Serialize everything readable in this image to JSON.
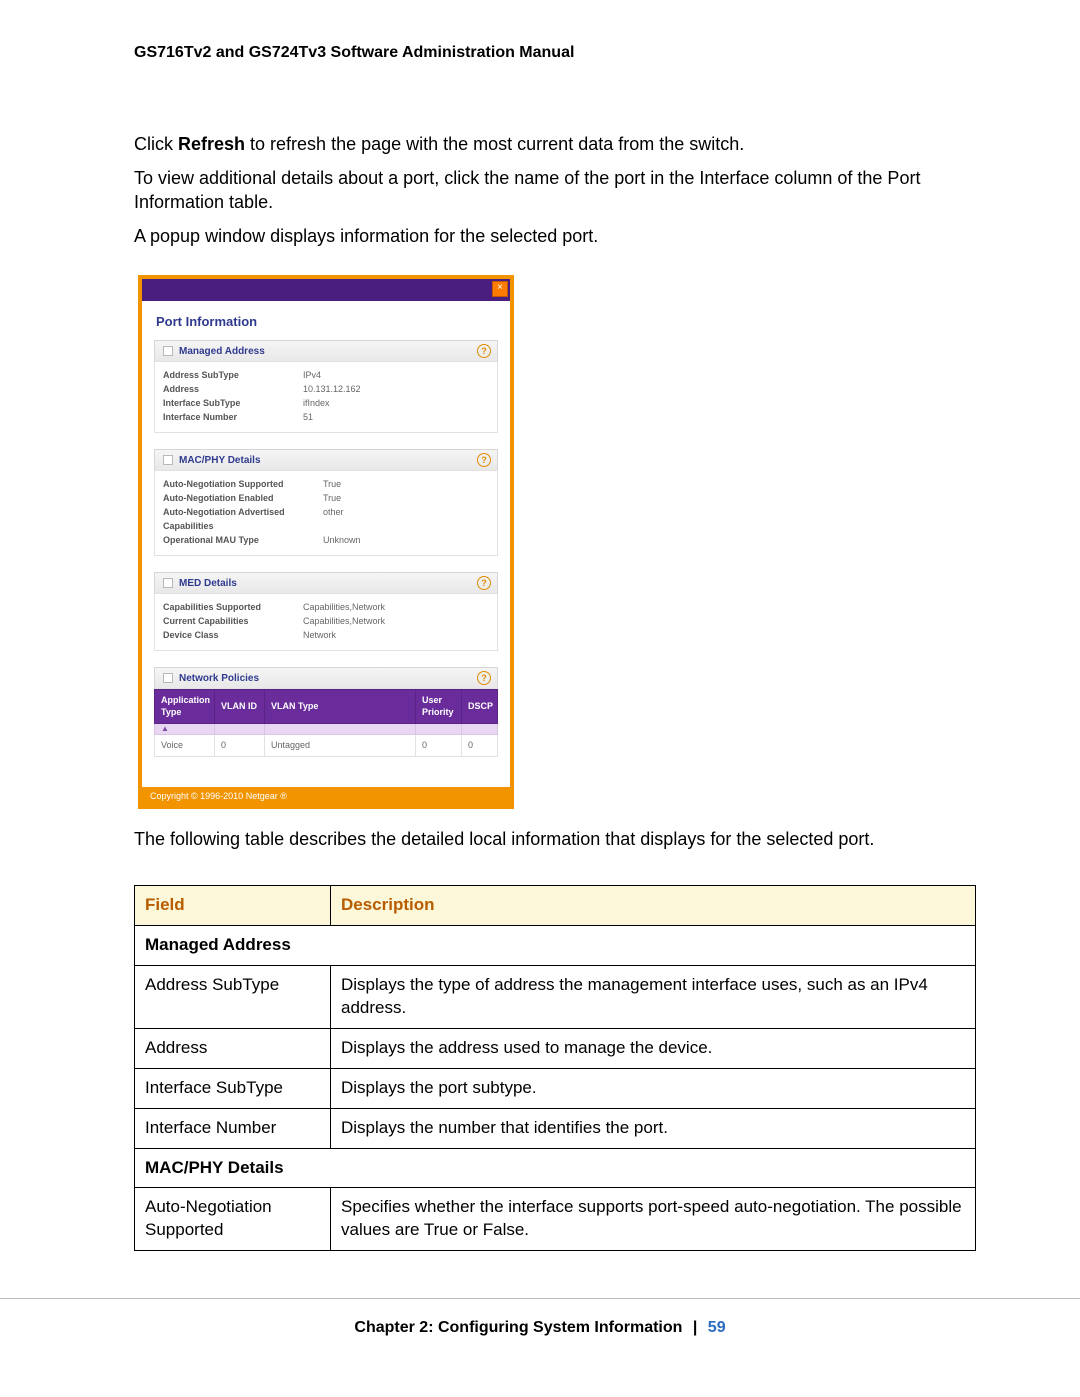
{
  "header": {
    "title": "GS716Tv2 and GS724Tv3 Software Administration Manual"
  },
  "paragraphs": {
    "p1a": "Click ",
    "p1bold": "Refresh",
    "p1b": " to refresh the page with the most current data from the switch.",
    "p2": "To view additional details about a port, click the name of the port in the Interface column of the Port Information table.",
    "p3": "A popup window displays information for the selected port.",
    "p4": "The following table describes the detailed local information that displays for the selected port."
  },
  "popup": {
    "title": "Port Information",
    "sections": {
      "managed": {
        "title": "Managed Address",
        "rows": [
          {
            "k": "Address SubType",
            "v": "IPv4"
          },
          {
            "k": "Address",
            "v": "10.131.12.162"
          },
          {
            "k": "Interface SubType",
            "v": "ifIndex"
          },
          {
            "k": "Interface Number",
            "v": "51"
          }
        ]
      },
      "macphy": {
        "title": "MAC/PHY Details",
        "rows": [
          {
            "k": "Auto-Negotiation Supported",
            "v": "True"
          },
          {
            "k": "Auto-Negotiation Enabled",
            "v": "True"
          },
          {
            "k": "Auto-Negotiation Advertised Capabilities",
            "v": "other"
          },
          {
            "k": "Operational MAU Type",
            "v": "Unknown"
          }
        ]
      },
      "med": {
        "title": "MED Details",
        "rows": [
          {
            "k": "Capabilities Supported",
            "v": "Capabilities,Network"
          },
          {
            "k": "Current Capabilities",
            "v": "Capabilities,Network"
          },
          {
            "k": "Device Class",
            "v": "Network"
          }
        ]
      },
      "np": {
        "title": "Network Policies",
        "columns": [
          "Application Type",
          "VLAN ID",
          "VLAN Type",
          "User Priority",
          "DSCP"
        ],
        "row": {
          "app": "Voice",
          "vlan": "0",
          "vtype": "Untagged",
          "prio": "0",
          "dscp": "0"
        }
      }
    },
    "copyright": "Copyright © 1996-2010 Netgear ®"
  },
  "field_table": {
    "head": {
      "c1": "Field",
      "c2": "Description"
    },
    "rows": [
      {
        "section": "Managed Address"
      },
      {
        "f": "Address SubType",
        "d": "Displays the type of address the management interface uses, such as an IPv4 address."
      },
      {
        "f": "Address",
        "d": "Displays the address used to manage the device."
      },
      {
        "f": "Interface SubType",
        "d": "Displays the port subtype."
      },
      {
        "f": "Interface Number",
        "d": "Displays the number that identifies the port."
      },
      {
        "section": "MAC/PHY Details"
      },
      {
        "f": "Auto-Negotiation Supported",
        "d": "Specifies whether the interface supports port-speed auto-negotiation. The possible values are True or False."
      }
    ]
  },
  "footer": {
    "chapter": "Chapter 2:  Configuring System Information",
    "sep": "|",
    "page": "59"
  },
  "icons": {
    "help": "?",
    "close": "×",
    "sort": "▲"
  }
}
